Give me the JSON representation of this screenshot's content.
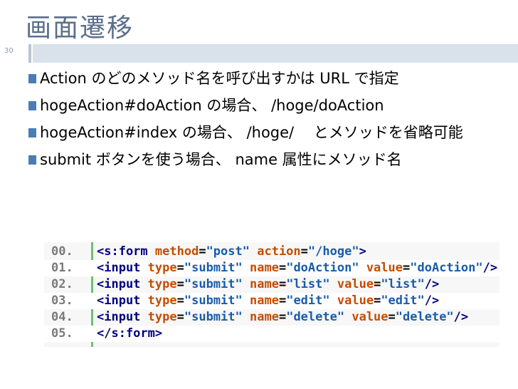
{
  "slide": {
    "title": "画面遷移",
    "number": "30"
  },
  "bullets": [
    "Action のどのメソッド名を呼び出すかは URL で指定",
    "hogeAction#doAction の場合、 /hoge/doAction",
    "hogeAction#index の場合、 /hoge/　 とメソッドを省略可能",
    "submit ボタンを使う場合、 name 属性にメソッド名"
  ],
  "code": {
    "lines": [
      {
        "num": "00.",
        "parts": [
          [
            "tag",
            "<s:form "
          ],
          [
            "attr",
            "method"
          ],
          [
            "eq",
            "="
          ],
          [
            "val",
            "\"post\""
          ],
          [
            "eq",
            " "
          ],
          [
            "attr",
            "action"
          ],
          [
            "eq",
            "="
          ],
          [
            "val",
            "\"/hoge\""
          ],
          [
            "tag",
            ">"
          ]
        ]
      },
      {
        "num": "01.",
        "parts": [
          [
            "tag",
            "<input "
          ],
          [
            "attr",
            "type"
          ],
          [
            "eq",
            "="
          ],
          [
            "val",
            "\"submit\""
          ],
          [
            "eq",
            " "
          ],
          [
            "attr",
            "name"
          ],
          [
            "eq",
            "="
          ],
          [
            "val",
            "\"doAction\""
          ],
          [
            "eq",
            " "
          ],
          [
            "attr",
            "value"
          ],
          [
            "eq",
            "="
          ],
          [
            "val",
            "\"doAction\""
          ],
          [
            "tag",
            "/>"
          ]
        ]
      },
      {
        "num": "02.",
        "parts": [
          [
            "tag",
            "<input "
          ],
          [
            "attr",
            "type"
          ],
          [
            "eq",
            "="
          ],
          [
            "val",
            "\"submit\""
          ],
          [
            "eq",
            " "
          ],
          [
            "attr",
            "name"
          ],
          [
            "eq",
            "="
          ],
          [
            "val",
            "\"list\""
          ],
          [
            "eq",
            " "
          ],
          [
            "attr",
            "value"
          ],
          [
            "eq",
            "="
          ],
          [
            "val",
            "\"list\""
          ],
          [
            "tag",
            "/>"
          ]
        ]
      },
      {
        "num": "03.",
        "parts": [
          [
            "tag",
            "<input "
          ],
          [
            "attr",
            "type"
          ],
          [
            "eq",
            "="
          ],
          [
            "val",
            "\"submit\""
          ],
          [
            "eq",
            " "
          ],
          [
            "attr",
            "name"
          ],
          [
            "eq",
            "="
          ],
          [
            "val",
            "\"edit\""
          ],
          [
            "eq",
            " "
          ],
          [
            "attr",
            "value"
          ],
          [
            "eq",
            "="
          ],
          [
            "val",
            "\"edit\""
          ],
          [
            "tag",
            "/>"
          ]
        ]
      },
      {
        "num": "04.",
        "parts": [
          [
            "tag",
            "<input "
          ],
          [
            "attr",
            "type"
          ],
          [
            "eq",
            "="
          ],
          [
            "val",
            "\"submit\""
          ],
          [
            "eq",
            " "
          ],
          [
            "attr",
            "name"
          ],
          [
            "eq",
            "="
          ],
          [
            "val",
            "\"delete\""
          ],
          [
            "eq",
            " "
          ],
          [
            "attr",
            "value"
          ],
          [
            "eq",
            "="
          ],
          [
            "val",
            "\"delete\""
          ],
          [
            "tag",
            "/>"
          ]
        ]
      },
      {
        "num": "05.",
        "parts": [
          [
            "tag",
            "</s:form>"
          ]
        ]
      }
    ]
  },
  "colors": {
    "title": "#5b6f8a",
    "bullet_marker": "#4a7db5",
    "band": "#d9e1ea",
    "code_tag": "#000080",
    "code_attr": "#c44d00",
    "code_value": "#1a5ca8"
  }
}
